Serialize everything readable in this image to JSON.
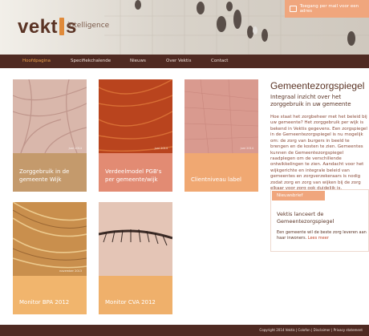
{
  "header": {
    "logo_text": "vektis",
    "tagline": "intelligence",
    "promo_text": "Toegang per mail voor een adres"
  },
  "nav": {
    "items": [
      {
        "label": "Hoofdpagina",
        "active": true
      },
      {
        "label": "Specifiekchalende"
      },
      {
        "label": "Nieuws"
      },
      {
        "label": "Over Vektis"
      },
      {
        "label": "Contact"
      }
    ]
  },
  "tiles": [
    {
      "label": "Zorggebruik in de gemeente Wijk",
      "badge": "juni 2014",
      "color": "#c49a6c"
    },
    {
      "label": "Verdeelmodel PGB's per gemeente/wijk",
      "badge": "juni 2014",
      "color": "#e28b73"
    },
    {
      "label": "Clientniveau label",
      "badge": "juni 2014",
      "color": "#f0a872"
    },
    {
      "label": "Monitor BPA 2012",
      "badge": "november 2013",
      "color": "#f1b56d"
    },
    {
      "label": "Monitor CVA 2012",
      "badge": "",
      "color": "#efb06b"
    }
  ],
  "article": {
    "title": "Gemeentezorgspiegel",
    "subtitle": "Integraal inzicht over het zorggebruik in uw gemeente",
    "paragraph": "Hoe staat het zorgbeheer met het beleid bij uw gemeente? Het zorggebruik per wijk is bekend in Vektis gegevens. Een zorgspiegel in de Gemeentezorgspiegel is nu mogelijk om: de zorg van burgers in beeld te brengen en de kosten te zien. Gemeentes kunnen de Gemeentezorgspiegel raadplegen om de verschillende ontwikkelingen te zien. Aandacht voor het wijkgerichte en integrale beleid van gemeentes en zorgverzekeraars is nodig zodat zorg en zorg van wijken bij de zorg elkaar voor zorg ook duidelijk is."
  },
  "info_box": {
    "tab_label": "Nieuwsbrief",
    "title": "Vektis lanceert de Gemeentezorgspiegel",
    "text": "Een gemeente wil de beste zorg leveren aan haar inwoners.",
    "more_link": "Lees meer"
  },
  "footer": {
    "text": "Copyright 2014 Vektis  |  Colofon  |  Disclaimer  |  Privacy statement"
  }
}
